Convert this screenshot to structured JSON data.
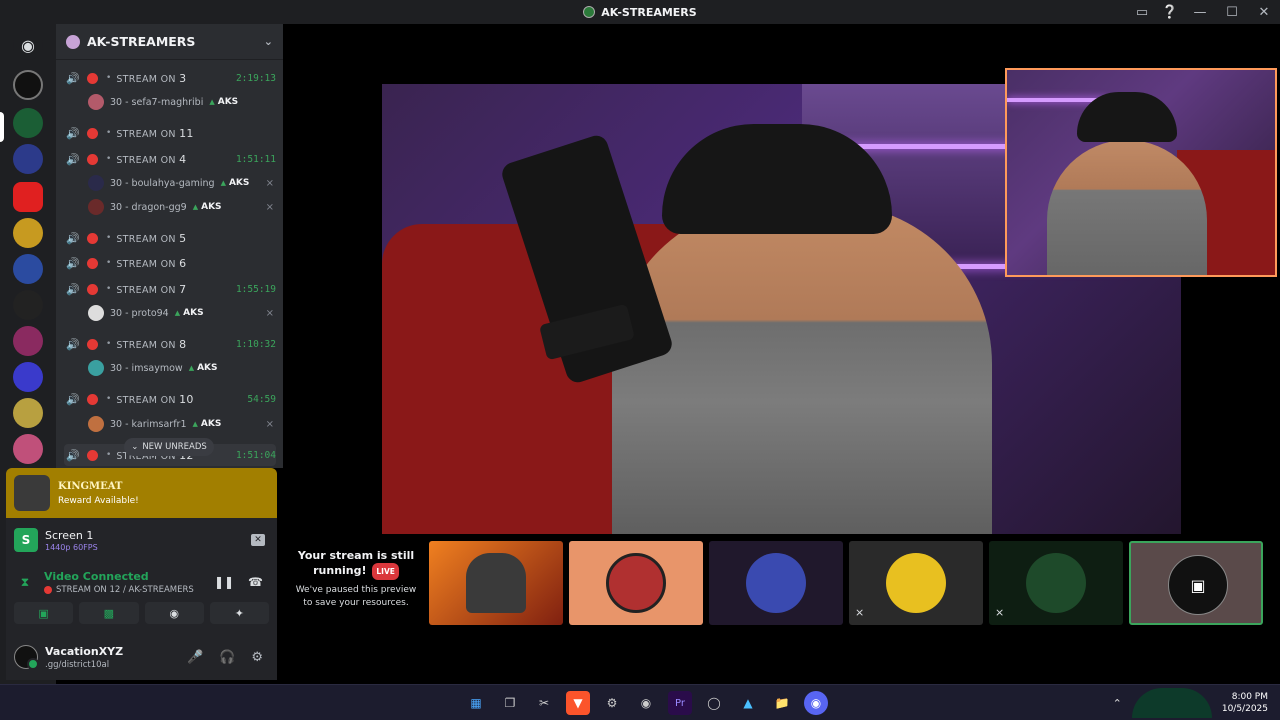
{
  "window": {
    "title": "AK-STREAMERS"
  },
  "server": {
    "name": "AK-STREAMERS"
  },
  "voice_channels": [
    {
      "label": "STREAM ON",
      "num": "3",
      "time": "2:19:13"
    },
    {
      "label": "STREAM ON",
      "num": "11",
      "time": ""
    },
    {
      "label": "STREAM ON",
      "num": "4",
      "time": "1:51:11"
    },
    {
      "label": "STREAM ON",
      "num": "5",
      "time": ""
    },
    {
      "label": "STREAM ON",
      "num": "6",
      "time": ""
    },
    {
      "label": "STREAM ON",
      "num": "7",
      "time": "1:55:19"
    },
    {
      "label": "STREAM ON",
      "num": "8",
      "time": "1:10:32"
    },
    {
      "label": "STREAM ON",
      "num": "10",
      "time": "54:59"
    },
    {
      "label": "STREAM ON",
      "num": "12",
      "time": "1:51:04"
    }
  ],
  "members": [
    {
      "name": "30 - sefa7-maghribi",
      "tag": "AKS"
    },
    {
      "name": "30 - boulahya-gaming",
      "tag": "AKS"
    },
    {
      "name": "30 - dragon-gg9",
      "tag": "AKS"
    },
    {
      "name": "30 - proto94",
      "tag": "AKS"
    },
    {
      "name": "30 - imsaymow",
      "tag": "AKS"
    },
    {
      "name": "30 - karimsarfr1",
      "tag": "AKS"
    }
  ],
  "new_unreads": "NEW UNREADS",
  "reward": {
    "name": "KINGMEAT",
    "subtitle": "Reward Available!"
  },
  "screen_share": {
    "initial": "S",
    "title": "Screen 1",
    "quality": "1440p 60FPS"
  },
  "voice_status": {
    "title": "Video Connected",
    "channel": "STREAM ON 12 / AK-STREAMERS"
  },
  "user": {
    "name": "VacationXYZ",
    "status": ".gg/district10al"
  },
  "stream_paused": {
    "title": "Your stream is still running!",
    "live_badge": "LIVE",
    "subtitle": "We've paused this preview to save your resources."
  },
  "clock": {
    "time": "8:00 PM",
    "date": "10/5/2025"
  },
  "colors": {
    "accent_green": "#23a55a",
    "live_red": "#da373c",
    "reward_gold": "#a27f00",
    "pip_border": "#ff9a5a"
  }
}
